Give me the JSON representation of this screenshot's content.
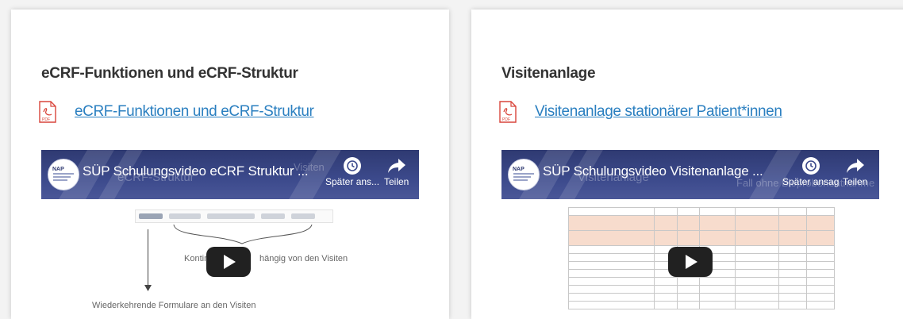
{
  "cards": [
    {
      "title": "eCRF-Funktionen und eCRF-Struktur",
      "pdf_link": "eCRF-Funktionen und eCRF-Struktur",
      "pdf_icon_label": "PDF",
      "video": {
        "title": "SÜP Schulungsvideo eCRF Struktur ...",
        "ghost_text": "eCRF-Struktur",
        "ghost_text_2": "Visiten",
        "watch_later": "Später ans...",
        "share": "Teilen",
        "thumb_text_1": "Kontinuierlich",
        "thumb_text_2": "hängig von den Visiten",
        "thumb_text_3": "Wiederkehrende Formulare an den Visiten"
      }
    },
    {
      "title": "Visitenanlage",
      "pdf_link": "Visitenanlage stationärer Patient*innen",
      "pdf_icon_label": "PDF",
      "video": {
        "title": "SÜP Schulungsvideo Visitenanlage ...",
        "ghost_text": "Visitenanlage",
        "ghost_text_2": "Fall ohne Bioprobenentnahme",
        "watch_later": "Später ansag",
        "share": "Teilen"
      }
    }
  ],
  "colors": {
    "link": "#2a7fc0",
    "video_bar": "#3c4a8c",
    "pdf_red": "#d9453b"
  }
}
